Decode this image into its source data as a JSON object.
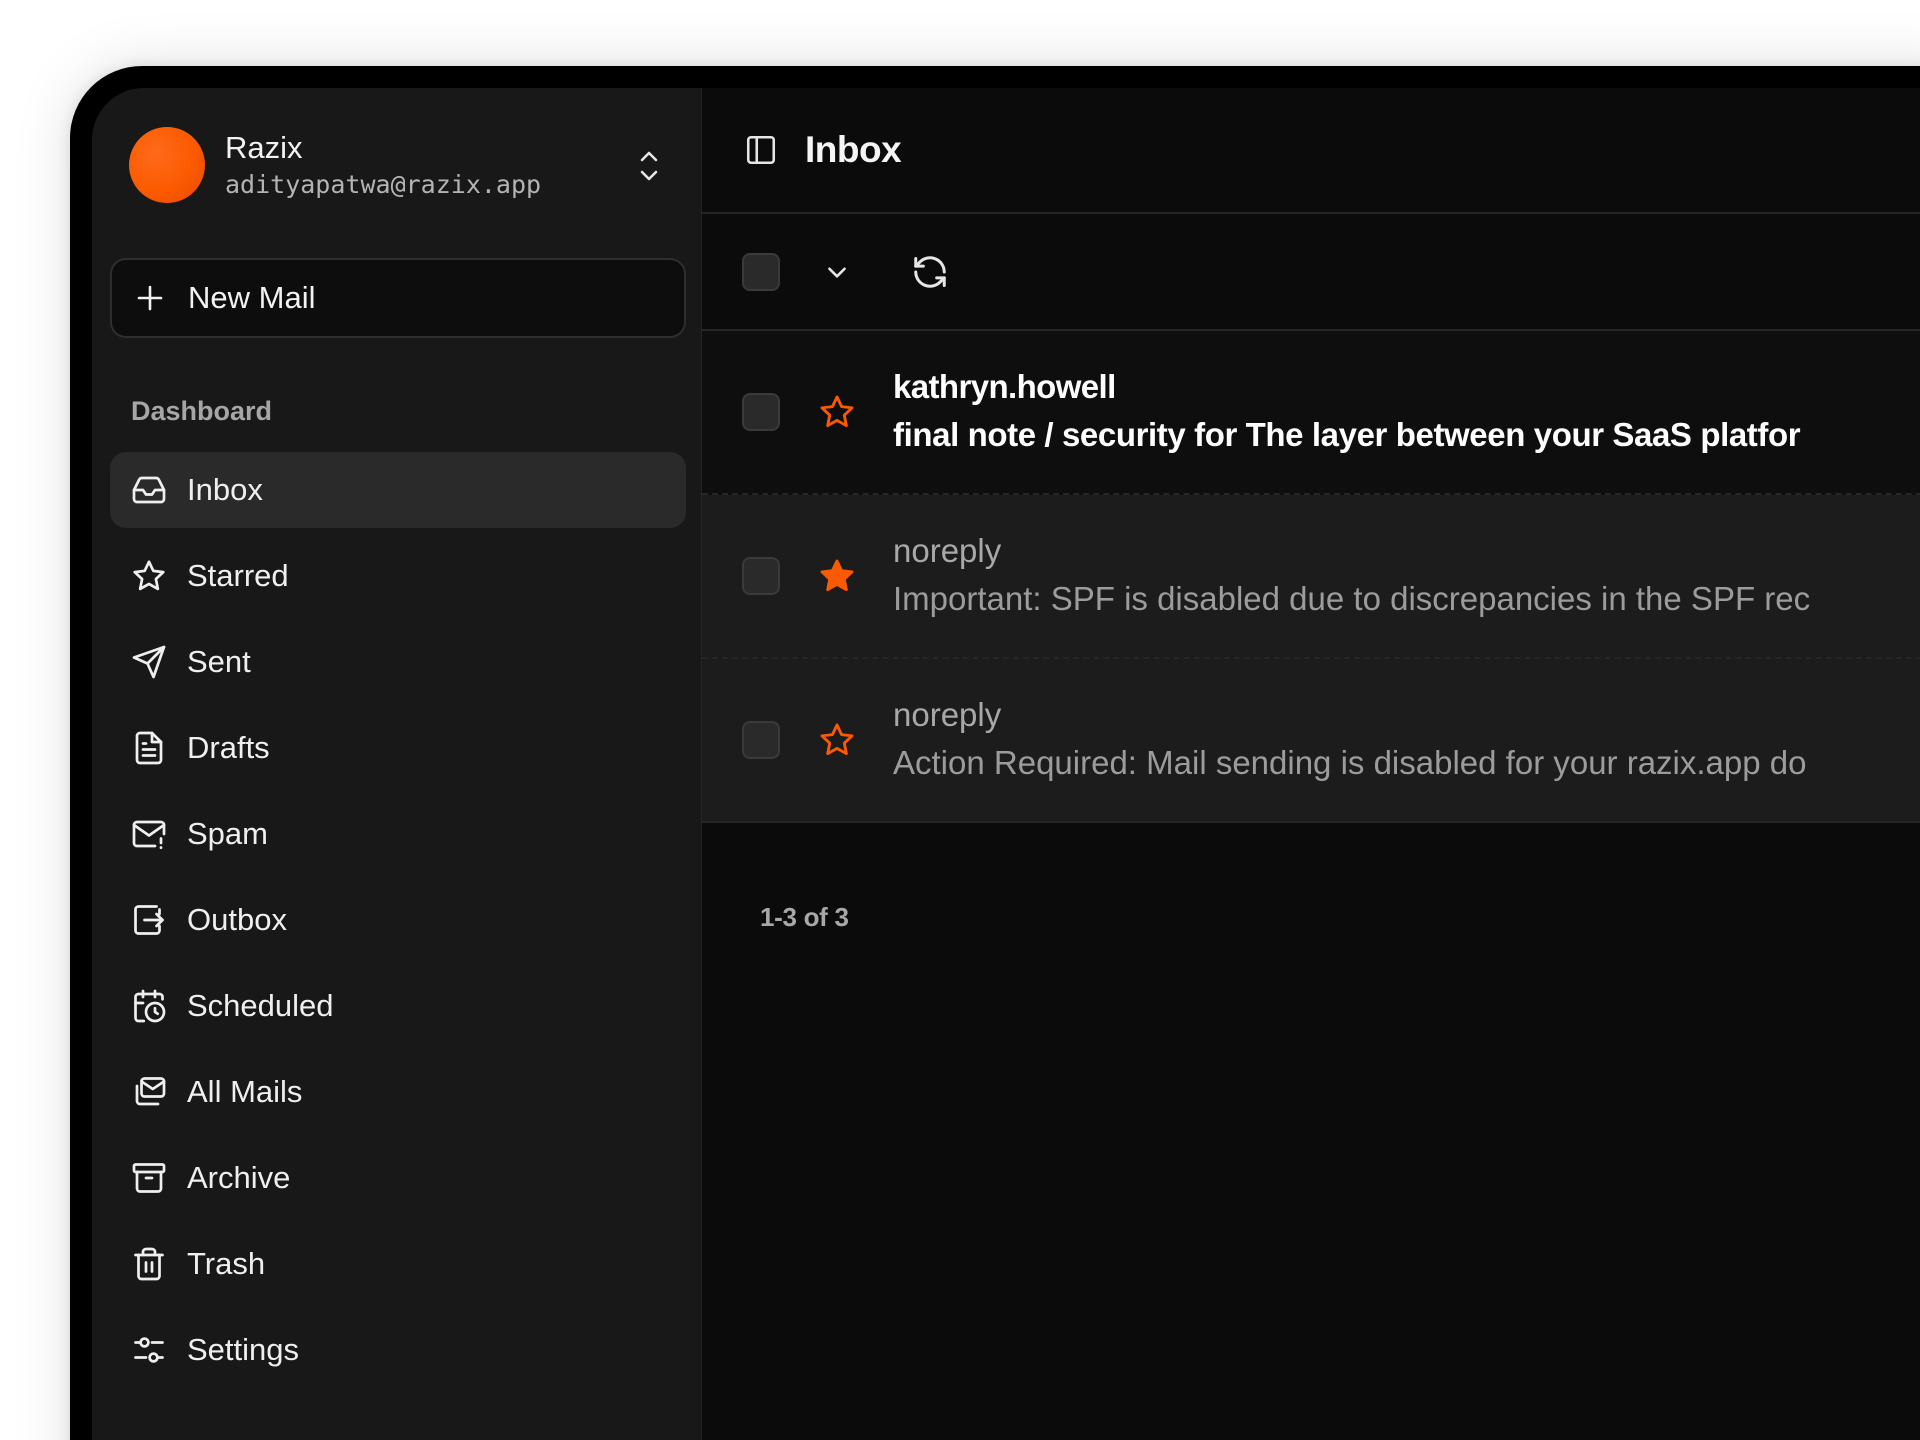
{
  "account": {
    "name": "Razix",
    "email": "adityapatwa@razix.app"
  },
  "compose": {
    "label": "New Mail"
  },
  "sidebar": {
    "section_label": "Dashboard",
    "items": [
      {
        "label": "Inbox",
        "icon": "inbox-icon",
        "active": true
      },
      {
        "label": "Starred",
        "icon": "star-icon"
      },
      {
        "label": "Sent",
        "icon": "send-icon"
      },
      {
        "label": "Drafts",
        "icon": "draft-icon"
      },
      {
        "label": "Spam",
        "icon": "spam-icon"
      },
      {
        "label": "Outbox",
        "icon": "outbox-icon"
      },
      {
        "label": "Scheduled",
        "icon": "scheduled-icon"
      },
      {
        "label": "All Mails",
        "icon": "all-mails-icon"
      },
      {
        "label": "Archive",
        "icon": "archive-icon"
      },
      {
        "label": "Trash",
        "icon": "trash-icon"
      },
      {
        "label": "Settings",
        "icon": "settings-icon"
      }
    ]
  },
  "header": {
    "title": "Inbox"
  },
  "emails": [
    {
      "sender": "kathryn.howell",
      "subject": "final note / security for The layer between your SaaS platfor",
      "starred": false,
      "unread": true
    },
    {
      "sender": "noreply",
      "subject": "Important: SPF is disabled due to discrepancies in the SPF rec",
      "starred": true,
      "unread": false
    },
    {
      "sender": "noreply",
      "subject": "Action Required: Mail sending is disabled for your razix.app do",
      "starred": false,
      "unread": false
    }
  ],
  "pagination": {
    "text": "1-3 of 3"
  },
  "colors": {
    "accent": "#fb5a00",
    "background": "#0b0b0b",
    "sidebar": "#181818"
  }
}
